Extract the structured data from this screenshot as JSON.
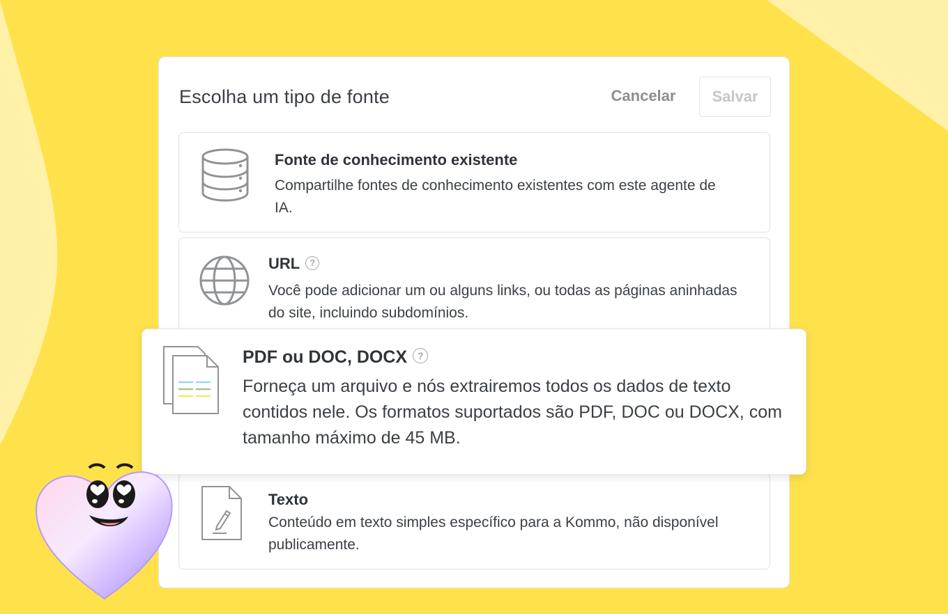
{
  "colors": {
    "background": "#ffe24b",
    "background_light": "#fff1a8",
    "panel": "#ffffff",
    "icon_gray": "#8f9296"
  },
  "dialog": {
    "title": "Escolha um tipo de fonte",
    "cancel_label": "Cancelar",
    "save_label": "Salvar"
  },
  "sources": [
    {
      "title": "Fonte de conhecimento existente",
      "description": "Compartilhe fontes de conhecimento existentes com este agente de IA.",
      "icon": "database-icon",
      "help": false
    },
    {
      "title": "URL",
      "description": "Você pode adicionar um ou alguns links, ou todas as páginas aninhadas do site, incluindo subdomínios.",
      "icon": "globe-icon",
      "help": true
    },
    {
      "title": "PDF ou DOC, DOCX",
      "description": "Forneça um arquivo e nós extrairemos todos os dados de texto contidos nele. Os formatos suportados são PDF, DOC ou DOCX, com tamanho máximo de 45 MB.",
      "icon": "documents-icon",
      "help": true
    },
    {
      "title": "Texto",
      "description": "Conteúdo em texto simples específico para a Kommo, não disponível publicamente.",
      "icon": "pen-document-icon",
      "help": false
    }
  ],
  "help_glyph": "?",
  "mascot": "heart-mascot-illustration"
}
